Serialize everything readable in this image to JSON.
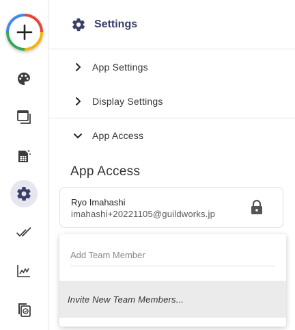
{
  "rail": {
    "items": [
      {
        "name": "theme-palette-button",
        "icon": "palette-icon"
      },
      {
        "name": "windows-button",
        "icon": "windows-icon"
      },
      {
        "name": "spreadsheet-button",
        "icon": "spreadsheet-sparkle-icon"
      },
      {
        "name": "settings-button",
        "icon": "gear-icon",
        "active": true
      },
      {
        "name": "tasks-done-button",
        "icon": "double-check-icon"
      },
      {
        "name": "analytics-button",
        "icon": "line-chart-icon"
      },
      {
        "name": "copy-check-button",
        "icon": "copy-check-icon"
      }
    ],
    "fab_icon": "plus-icon"
  },
  "header": {
    "title": "Settings",
    "icon": "gear-icon"
  },
  "nav": {
    "app_settings": "App Settings",
    "display_settings": "Display Settings",
    "app_access": "App Access"
  },
  "section": {
    "title": "App Access"
  },
  "member": {
    "name": "Ryo Imahashi",
    "email": "imahashi+20221105@guildworks.jp",
    "icon": "lock-icon"
  },
  "dropdown": {
    "placeholder": "Add Team Member",
    "value": "",
    "option": "Invite New Team Members..."
  },
  "colors": {
    "accent": "#3a3f6b",
    "active_bg": "#e6e7ee",
    "option_highlight": "#ebebeb"
  }
}
